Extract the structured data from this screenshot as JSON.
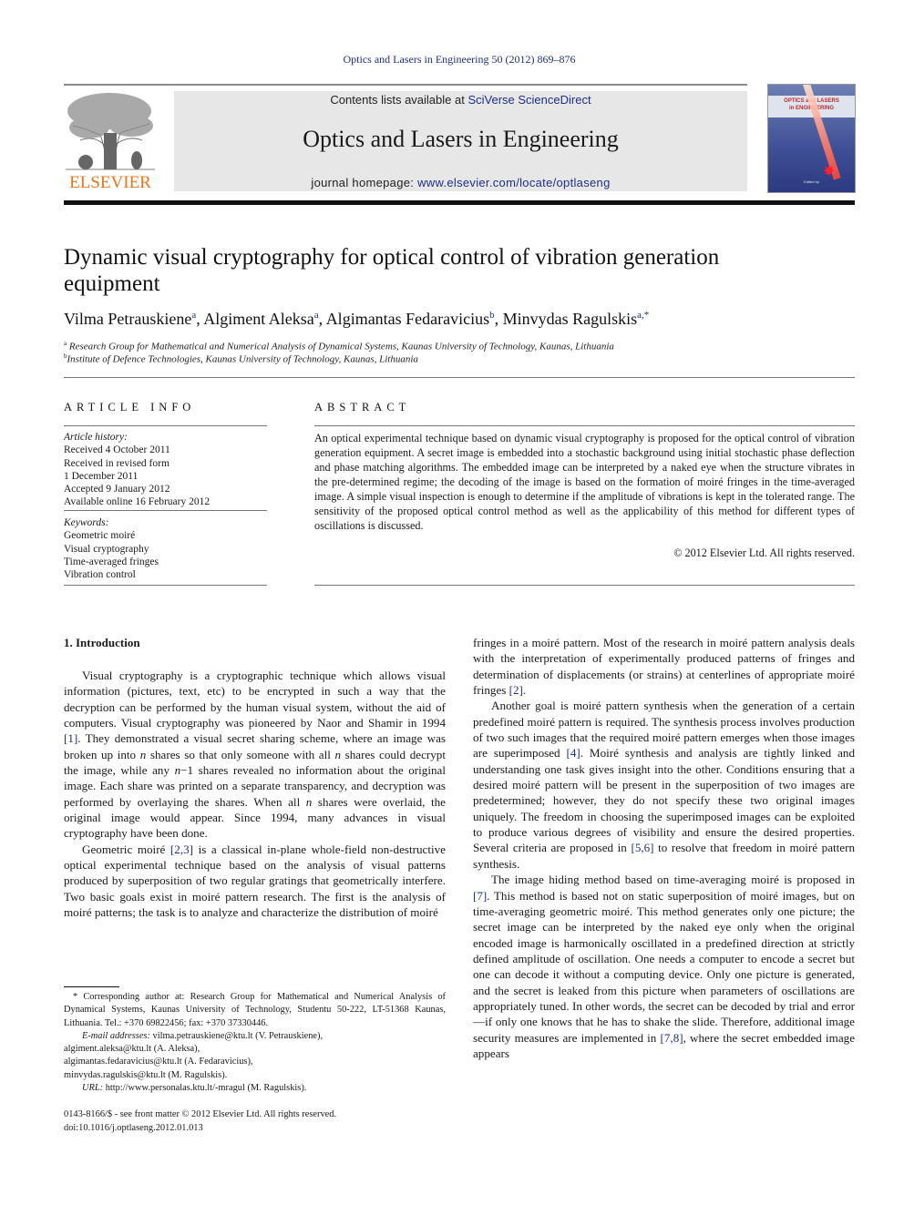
{
  "journal_header": {
    "running_head": "Optics and Lasers in Engineering 50 (2012) 869–876",
    "publisher_logo_text": "ELSEVIER",
    "contents_prefix": "Contents lists available at ",
    "contents_link": "SciVerse ScienceDirect",
    "journal_title": "Optics and Lasers in Engineering",
    "homepage_prefix": "journal homepage: ",
    "homepage_link": "www.elsevier.com/locate/optlaseng",
    "cover": {
      "title_line1": "OPTICS and LASERS",
      "title_line2": "in ENGINEERING",
      "edited_by": "Edited by"
    }
  },
  "article": {
    "title": "Dynamic visual cryptography for optical control of vibration generation equipment",
    "authors": [
      {
        "name": "Vilma Petrauskiene",
        "aff": "a"
      },
      {
        "name": "Algiment Aleksa",
        "aff": "a"
      },
      {
        "name": "Algimantas Fedaravicius",
        "aff": "b"
      },
      {
        "name": "Minvydas Ragulskis",
        "aff": "a,*"
      }
    ],
    "affiliations": [
      {
        "mark": "a",
        "text": "Research Group for Mathematical and Numerical Analysis of Dynamical Systems, Kaunas University of Technology, Kaunas, Lithuania"
      },
      {
        "mark": "b",
        "text": "Institute of Defence Technologies, Kaunas University of Technology, Kaunas, Lithuania"
      }
    ]
  },
  "article_info": {
    "heading": "ARTICLE INFO",
    "history_label": "Article history:",
    "history": [
      "Received 4 October 2011",
      "Received in revised form",
      "1 December 2011",
      "Accepted 9 January 2012",
      "Available online 16 February 2012"
    ],
    "keywords_label": "Keywords:",
    "keywords": [
      "Geometric moiré",
      "Visual cryptography",
      "Time-averaged fringes",
      "Vibration control"
    ]
  },
  "abstract": {
    "heading": "ABSTRACT",
    "text": "An optical experimental technique based on dynamic visual cryptography is proposed for the optical control of vibration generation equipment. A secret image is embedded into a stochastic background using initial stochastic phase deflection and phase matching algorithms. The embedded image can be interpreted by a naked eye when the structure vibrates in the pre-determined regime; the decoding of the image is based on the formation of moiré fringes in the time-averaged image. A simple visual inspection is enough to determine if the amplitude of vibrations is kept in the tolerated range. The sensitivity of the proposed optical control method as well as the applicability of this method for different types of oscillations is discussed.",
    "copyright": "© 2012 Elsevier Ltd. All rights reserved."
  },
  "body": {
    "section_heading": "1.  Introduction",
    "left_paragraphs": [
      {
        "parts": [
          {
            "t": "Visual cryptography is a cryptographic technique which allows visual information (pictures, text, etc) to be encrypted in such a way that the decryption can be performed by the human visual system, without the aid of computers. Visual cryptography was pioneered by Naor and Shamir in 1994 "
          },
          {
            "ref": "[1]"
          },
          {
            "t": ". They demonstrated a visual secret sharing scheme, where an image was broken up into "
          },
          {
            "i": "n"
          },
          {
            "t": " shares so that only someone with all "
          },
          {
            "i": "n"
          },
          {
            "t": " shares could decrypt the image, while any "
          },
          {
            "i": "n"
          },
          {
            "t": "−1 shares revealed no information about the original image. Each share was printed on a separate transparency, and decryption was performed by overlaying the shares. When all "
          },
          {
            "i": "n"
          },
          {
            "t": " shares were overlaid, the original image would appear. Since 1994, many advances in visual cryptography have been done."
          }
        ]
      },
      {
        "parts": [
          {
            "t": "Geometric moiré "
          },
          {
            "ref": "[2,3]"
          },
          {
            "t": " is a classical in-plane whole-field non-destructive optical experimental technique based on the analysis of visual patterns produced by superposition of two regular gratings that geometrically interfere. Two basic goals exist in moiré pattern research. The first is the analysis of moiré patterns; the task is to analyze and characterize the distribution of moiré"
          }
        ]
      }
    ],
    "right_paragraphs": [
      {
        "noindent": true,
        "parts": [
          {
            "t": "fringes in a moiré pattern. Most of the research in moiré pattern analysis deals with the interpretation of experimentally produced patterns of fringes and determination of displacements (or strains) at centerlines of appropriate moiré fringes "
          },
          {
            "ref": "[2]"
          },
          {
            "t": "."
          }
        ]
      },
      {
        "parts": [
          {
            "t": "Another goal is moiré pattern synthesis when the generation of a certain predefined moiré pattern is required. The synthesis process involves production of two such images that the required moiré pattern emerges when those images are superimposed "
          },
          {
            "ref": "[4]"
          },
          {
            "t": ". Moiré synthesis and analysis are tightly linked and understanding one task gives insight into the other. Conditions ensuring that a desired moiré pattern will be present in the superposition of two images are predetermined; however, they do not specify these two original images uniquely. The freedom in choosing the superimposed images can be exploited to produce various degrees of visibility and ensure the desired properties. Several criteria are proposed in "
          },
          {
            "ref": "[5,6]"
          },
          {
            "t": " to resolve that freedom in moiré pattern synthesis."
          }
        ]
      },
      {
        "parts": [
          {
            "t": "The image hiding method based on time-averaging moiré is proposed in "
          },
          {
            "ref": "[7]"
          },
          {
            "t": ". This method is based not on static superposition of moiré images, but on time-averaging geometric moiré. This method generates only one picture; the secret image can be interpreted by the naked eye only when the original encoded image is harmonically oscillated in a predefined direction at strictly defined amplitude of oscillation. One needs a computer to encode a secret but one can decode it without a computing device. Only one picture is generated, and the secret is leaked from this picture when parameters of oscillations are appropriately tuned. In other words, the secret can be decoded by trial and error—if only one knows that he has to shake the slide. Therefore, additional image security measures are implemented in "
          },
          {
            "ref": "[7,8]"
          },
          {
            "t": ", where the secret embedded image appears"
          }
        ]
      }
    ]
  },
  "footnotes": {
    "corresponding": "* Corresponding author at: Research Group for Mathematical and Numerical Analysis of Dynamical Systems, Kaunas University of Technology, Studentu 50-222, LT-51368 Kaunas, Lithuania. Tel.: +370 69822456; fax: +370 37330446.",
    "email_label": "E-mail addresses:",
    "emails": [
      "vilma.petrauskiene@ktu.lt (V. Petrauskiene),",
      "algiment.aleksa@ktu.lt (A. Aleksa),",
      "algimantas.fedaravicius@ktu.lt (A. Fedaravicius),",
      "minvydas.ragulskis@ktu.lt (M. Ragulskis)."
    ],
    "url_label": "URL:",
    "url": "http://www.personalas.ktu.lt/-mragul (M. Ragulskis).",
    "front_matter": "0143-8166/$ - see front matter © 2012 Elsevier Ltd. All rights reserved.",
    "doi": "doi:10.1016/j.optlaseng.2012.01.013"
  },
  "colors": {
    "link": "#1f2e8c",
    "elsevier_orange": "#e8751a",
    "banner_gray": "#e7e7e7"
  }
}
